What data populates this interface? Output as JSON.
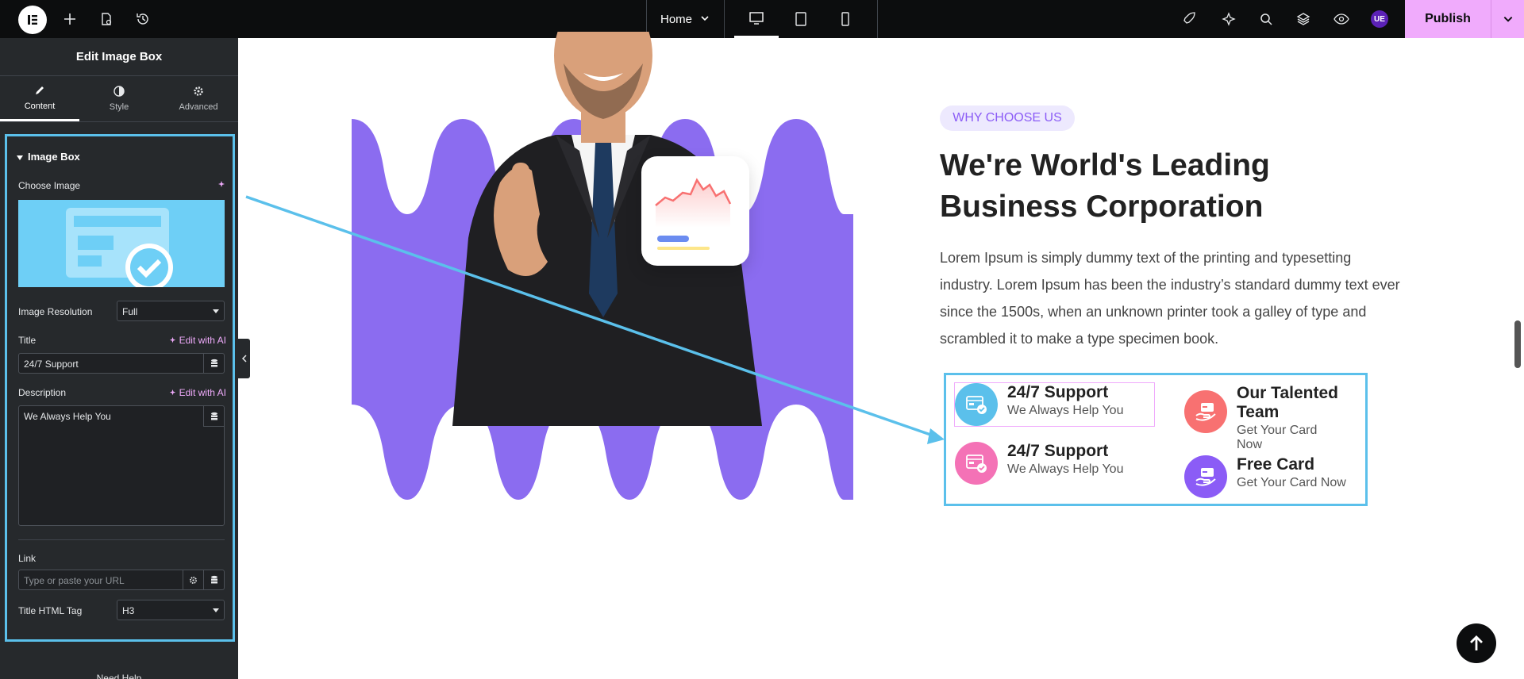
{
  "topbar": {
    "page_selector": "Home",
    "user_badge": "UE",
    "publish_label": "Publish"
  },
  "panel": {
    "title": "Edit Image Box",
    "tabs": [
      {
        "label": "Content",
        "active": true
      },
      {
        "label": "Style",
        "active": false
      },
      {
        "label": "Advanced",
        "active": false
      }
    ],
    "section_title": "Image Box",
    "choose_image_label": "Choose Image",
    "image_resolution_label": "Image Resolution",
    "image_resolution_value": "Full",
    "title_label": "Title",
    "title_value": "24/7 Support",
    "edit_ai_label": "Edit with AI",
    "description_label": "Description",
    "description_value": "We Always Help You",
    "link_label": "Link",
    "link_placeholder": "Type or paste your URL",
    "title_tag_label": "Title HTML Tag",
    "title_tag_value": "H3",
    "need_help": "Need Help"
  },
  "canvas": {
    "badge": "WHY CHOOSE US",
    "headline_line1": "We're World's Leading",
    "headline_line2": "Business Corporation",
    "paragraph": "Lorem Ipsum is simply dummy text of the printing and typesetting industry. Lorem Ipsum has been the industry’s standard dummy text ever since the 1500s, when an unknown printer took a galley of type and scrambled it to make a type specimen book.",
    "boxes": [
      {
        "title": "24/7 Support",
        "desc": "We Always Help You",
        "color": "#5bc0eb"
      },
      {
        "title": "Our Talented Team",
        "desc": "Get Your Card Now",
        "color": "#f87171"
      },
      {
        "title": "24/7 Support",
        "desc": "We Always Help You",
        "color": "#f472b6"
      },
      {
        "title": "Free Card",
        "desc": "Get Your Card Now",
        "color": "#8b5cf6"
      }
    ]
  },
  "colors": {
    "accent": "#f0abfc",
    "selection": "#5bc0eb",
    "wave": "#8b6cf0"
  }
}
